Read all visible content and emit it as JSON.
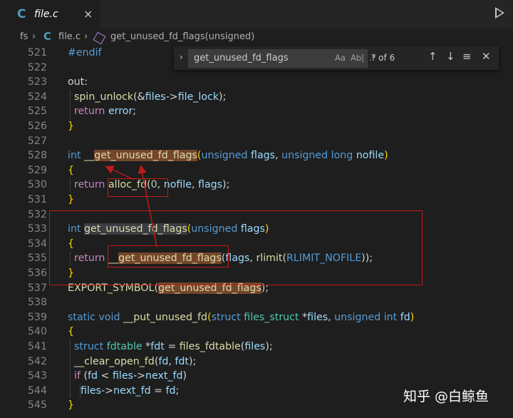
{
  "tab": {
    "icon": "C",
    "title": "file.c",
    "close": "×"
  },
  "breadcrumb": {
    "folder": "fs",
    "sep1": "›",
    "file_icon": "C",
    "file": "file.c",
    "sep2": "›",
    "symbol": "get_unused_fd_flags(unsigned)"
  },
  "find": {
    "toggle": "›",
    "value": "get_unused_fd_flags",
    "opt_case": "Aa",
    "opt_word": "Ab|",
    "opt_regex": ".*",
    "count": "? of 6",
    "prev": "↑",
    "next": "↓",
    "selection": "≡",
    "close": "✕"
  },
  "watermark": "知乎 @白鲸鱼",
  "lines": [
    {
      "n": "521",
      "tokens": [
        {
          "t": "#endif",
          "c": "mac"
        }
      ]
    },
    {
      "n": "522",
      "tokens": []
    },
    {
      "n": "523",
      "tokens": [
        {
          "t": "out:",
          "c": "pl"
        }
      ]
    },
    {
      "n": "524",
      "tokens": [
        {
          "t": "  "
        },
        {
          "t": "spin_unlock",
          "c": "fn"
        },
        {
          "t": "(&",
          "c": "pl"
        },
        {
          "t": "files",
          "c": "var"
        },
        {
          "t": "->",
          "c": "pl"
        },
        {
          "t": "file_lock",
          "c": "var"
        },
        {
          "t": ");",
          "c": "pl"
        }
      ]
    },
    {
      "n": "525",
      "tokens": [
        {
          "t": "  "
        },
        {
          "t": "return",
          "c": "ctl"
        },
        {
          "t": " ",
          "c": "pl"
        },
        {
          "t": "error",
          "c": "var"
        },
        {
          "t": ";",
          "c": "pl"
        }
      ]
    },
    {
      "n": "526",
      "tokens": [
        {
          "t": "}",
          "c": "br"
        }
      ]
    },
    {
      "n": "527",
      "tokens": []
    },
    {
      "n": "528",
      "tokens": [
        {
          "t": "int",
          "c": "kw"
        },
        {
          "t": " ",
          "c": "pl"
        },
        {
          "t": "__",
          "c": "fn"
        },
        {
          "t": "get_unused_fd_flags",
          "c": "fn hl"
        },
        {
          "t": "(",
          "c": "br"
        },
        {
          "t": "unsigned",
          "c": "kw"
        },
        {
          "t": " ",
          "c": "pl"
        },
        {
          "t": "flags",
          "c": "var"
        },
        {
          "t": ", ",
          "c": "pl"
        },
        {
          "t": "unsigned long",
          "c": "kw"
        },
        {
          "t": " ",
          "c": "pl"
        },
        {
          "t": "nofile",
          "c": "var"
        },
        {
          "t": ")",
          "c": "br"
        }
      ]
    },
    {
      "n": "529",
      "tokens": [
        {
          "t": "{",
          "c": "br"
        }
      ]
    },
    {
      "n": "530",
      "tokens": [
        {
          "t": "  "
        },
        {
          "t": "return",
          "c": "ctl"
        },
        {
          "t": " ",
          "c": "pl"
        },
        {
          "t": "alloc_fd",
          "c": "fn"
        },
        {
          "t": "(",
          "c": "pl"
        },
        {
          "t": "0",
          "c": "num"
        },
        {
          "t": ", ",
          "c": "pl"
        },
        {
          "t": "nofile",
          "c": "var"
        },
        {
          "t": ", ",
          "c": "pl"
        },
        {
          "t": "flags",
          "c": "var"
        },
        {
          "t": ");",
          "c": "pl"
        }
      ]
    },
    {
      "n": "531",
      "tokens": [
        {
          "t": "}",
          "c": "br"
        }
      ]
    },
    {
      "n": "532",
      "tokens": []
    },
    {
      "n": "533",
      "tokens": [
        {
          "t": "int",
          "c": "kw"
        },
        {
          "t": " ",
          "c": "pl"
        },
        {
          "t": "get_unused_fd_flags",
          "c": "fn hlw"
        },
        {
          "t": "(",
          "c": "br"
        },
        {
          "t": "unsigned",
          "c": "kw"
        },
        {
          "t": " ",
          "c": "pl"
        },
        {
          "t": "flags",
          "c": "var"
        },
        {
          "t": ")",
          "c": "br"
        }
      ]
    },
    {
      "n": "534",
      "tokens": [
        {
          "t": "{",
          "c": "br"
        }
      ]
    },
    {
      "n": "535",
      "tokens": [
        {
          "t": "  "
        },
        {
          "t": "return",
          "c": "ctl"
        },
        {
          "t": " ",
          "c": "pl"
        },
        {
          "t": "__",
          "c": "fn"
        },
        {
          "t": "get_unused_fd_flags",
          "c": "fn hl"
        },
        {
          "t": "(",
          "c": "pl"
        },
        {
          "t": "flags",
          "c": "var"
        },
        {
          "t": ", ",
          "c": "pl"
        },
        {
          "t": "rlimit",
          "c": "fn"
        },
        {
          "t": "(",
          "c": "pl"
        },
        {
          "t": "RLIMIT_NOFILE",
          "c": "mac"
        },
        {
          "t": "));",
          "c": "pl"
        }
      ]
    },
    {
      "n": "536",
      "tokens": [
        {
          "t": "}",
          "c": "br"
        }
      ]
    },
    {
      "n": "537",
      "tokens": [
        {
          "t": "EXPORT_SYMBOL",
          "c": "fn"
        },
        {
          "t": "(",
          "c": "pl"
        },
        {
          "t": "get_unused_fd_flags",
          "c": "fn hl"
        },
        {
          "t": ");",
          "c": "pl"
        }
      ]
    },
    {
      "n": "538",
      "tokens": []
    },
    {
      "n": "539",
      "tokens": [
        {
          "t": "static void",
          "c": "kw"
        },
        {
          "t": " ",
          "c": "pl"
        },
        {
          "t": "__put_unused_fd",
          "c": "fn"
        },
        {
          "t": "(",
          "c": "br"
        },
        {
          "t": "struct",
          "c": "kw"
        },
        {
          "t": " ",
          "c": "pl"
        },
        {
          "t": "files_struct",
          "c": "typ"
        },
        {
          "t": " *",
          "c": "pl"
        },
        {
          "t": "files",
          "c": "var"
        },
        {
          "t": ", ",
          "c": "pl"
        },
        {
          "t": "unsigned int",
          "c": "kw"
        },
        {
          "t": " ",
          "c": "pl"
        },
        {
          "t": "fd",
          "c": "var"
        },
        {
          "t": ")",
          "c": "br"
        }
      ]
    },
    {
      "n": "540",
      "tokens": [
        {
          "t": "{",
          "c": "br"
        }
      ]
    },
    {
      "n": "541",
      "tokens": [
        {
          "t": "  "
        },
        {
          "t": "struct",
          "c": "kw"
        },
        {
          "t": " ",
          "c": "pl"
        },
        {
          "t": "fdtable",
          "c": "typ"
        },
        {
          "t": " *",
          "c": "pl"
        },
        {
          "t": "fdt",
          "c": "var"
        },
        {
          "t": " = ",
          "c": "pl"
        },
        {
          "t": "files_fdtable",
          "c": "fn"
        },
        {
          "t": "(",
          "c": "pl"
        },
        {
          "t": "files",
          "c": "var"
        },
        {
          "t": ");",
          "c": "pl"
        }
      ]
    },
    {
      "n": "542",
      "tokens": [
        {
          "t": "  "
        },
        {
          "t": "__clear_open_fd",
          "c": "fn"
        },
        {
          "t": "(",
          "c": "pl"
        },
        {
          "t": "fd",
          "c": "var"
        },
        {
          "t": ", ",
          "c": "pl"
        },
        {
          "t": "fdt",
          "c": "var"
        },
        {
          "t": ");",
          "c": "pl"
        }
      ]
    },
    {
      "n": "543",
      "tokens": [
        {
          "t": "  "
        },
        {
          "t": "if",
          "c": "ctl"
        },
        {
          "t": " (",
          "c": "pl"
        },
        {
          "t": "fd",
          "c": "var"
        },
        {
          "t": " < ",
          "c": "pl"
        },
        {
          "t": "files",
          "c": "var"
        },
        {
          "t": "->",
          "c": "pl"
        },
        {
          "t": "next_fd",
          "c": "var"
        },
        {
          "t": ")",
          "c": "pl"
        }
      ]
    },
    {
      "n": "544",
      "tokens": [
        {
          "t": "    "
        },
        {
          "t": "files",
          "c": "var"
        },
        {
          "t": "->",
          "c": "pl"
        },
        {
          "t": "next_fd",
          "c": "var"
        },
        {
          "t": " = ",
          "c": "pl"
        },
        {
          "t": "fd",
          "c": "var"
        },
        {
          "t": ";",
          "c": "pl"
        }
      ]
    },
    {
      "n": "545",
      "tokens": [
        {
          "t": "}",
          "c": "br"
        }
      ]
    }
  ]
}
